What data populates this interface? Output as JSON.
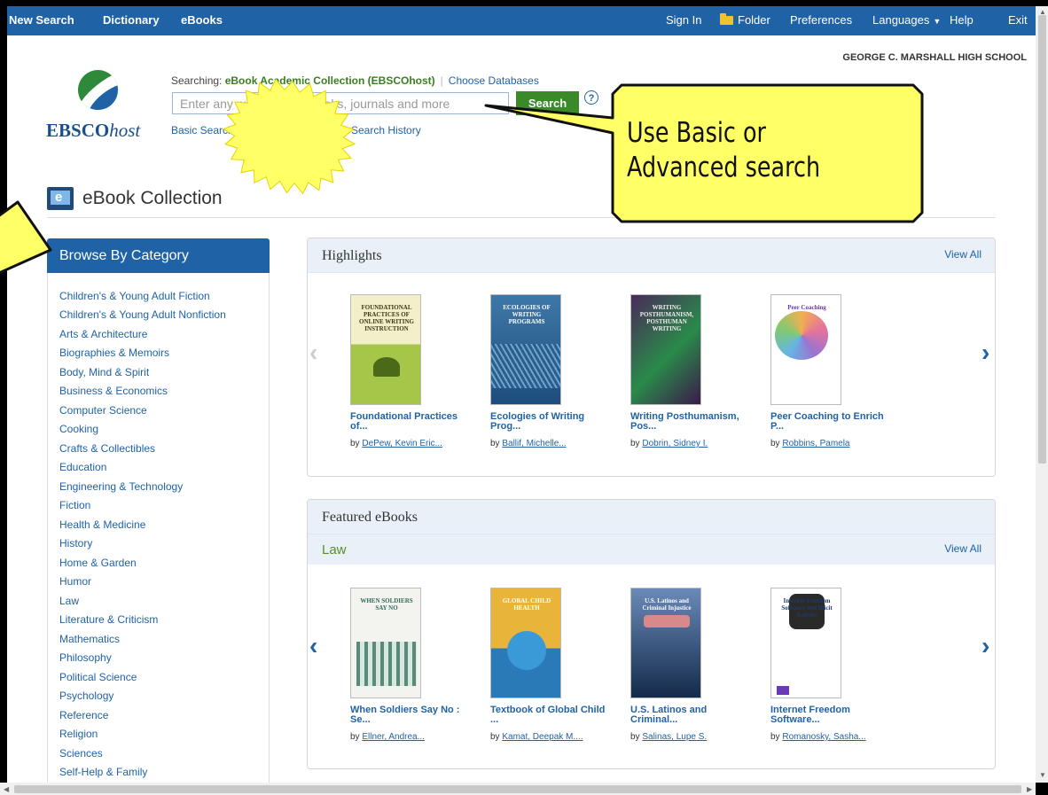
{
  "topbar": {
    "new_search": "New Search",
    "dictionary": "Dictionary",
    "ebooks": "eBooks",
    "sign_in": "Sign In",
    "folder": "Folder",
    "preferences": "Preferences",
    "languages": "Languages",
    "help": "Help",
    "exit": "Exit"
  },
  "institution": "GEORGE C. MARSHALL HIGH SCHOOL",
  "logo": {
    "brand": "EBSCO",
    "suffix": "host"
  },
  "search": {
    "searching_label": "Searching:",
    "database": "eBook Academic Collection (EBSCOhost)",
    "choose_databases": "Choose Databases",
    "placeholder": "Enter any words to find books, journals and more",
    "button": "Search",
    "help": "?",
    "basic": "Basic Search",
    "advanced": "Advanced Search",
    "history": "Search History"
  },
  "collection_title": "eBook Collection",
  "sidebar": {
    "title": "Browse By Category",
    "categories": [
      "Children's & Young Adult Fiction",
      "Children's & Young Adult Nonfiction",
      "Arts & Architecture",
      "Biographies & Memoirs",
      "Body, Mind & Spirit",
      "Business & Economics",
      "Computer Science",
      "Cooking",
      "Crafts & Collectibles",
      "Education",
      "Engineering & Technology",
      "Fiction",
      "Health & Medicine",
      "History",
      "Home & Garden",
      "Humor",
      "Law",
      "Literature & Criticism",
      "Mathematics",
      "Philosophy",
      "Political Science",
      "Psychology",
      "Reference",
      "Religion",
      "Sciences",
      "Self-Help & Family"
    ]
  },
  "highlights": {
    "title": "Highlights",
    "view_all": "View All",
    "prev": "‹",
    "next": "›",
    "books": [
      {
        "title": "Foundational Practices of...",
        "by": "by",
        "author": "DePew, Kevin Eric...",
        "cover_text": "FOUNDATIONAL PRACTICES OF ONLINE WRITING INSTRUCTION"
      },
      {
        "title": "Ecologies of Writing Prog...",
        "by": "by",
        "author": "Ballif, Michelle...",
        "cover_text": "ECOLOGIES OF WRITING PROGRAMS"
      },
      {
        "title": "Writing Posthumanism, Pos...",
        "by": "by",
        "author": "Dobrin, Sidney I.",
        "cover_text": "WRITING POSTHUMANISM, POSTHUMAN WRITING"
      },
      {
        "title": "Peer Coaching to Enrich P...",
        "by": "by",
        "author": "Robbins, Pamela",
        "cover_text": "Peer Coaching"
      }
    ]
  },
  "featured": {
    "title": "Featured eBooks",
    "subject": "Law",
    "view_all": "View All",
    "prev": "‹",
    "next": "›",
    "books": [
      {
        "title": "When Soldiers Say No : Se...",
        "by": "by",
        "author": "Ellner, Andrea...",
        "cover_text": "WHEN SOLDIERS SAY NO"
      },
      {
        "title": "Textbook of Global Child ...",
        "by": "by",
        "author": "Kamat, Deepak M....",
        "cover_text": "GLOBAL CHILD HEALTH"
      },
      {
        "title": "U.S. Latinos and Criminal...",
        "by": "by",
        "author": "Salinas, Lupe S.",
        "cover_text": "U.S. Latinos and Criminal Injustice"
      },
      {
        "title": "Internet Freedom Software...",
        "by": "by",
        "author": "Romanosky, Sasha...",
        "cover_text": "Internet Freedom Software and Illicit Activity"
      }
    ]
  },
  "annotation": {
    "line1": "Use Basic or",
    "line2": "Advanced search"
  },
  "colors": {
    "topbar": "#1f62a6",
    "link": "#1f62a6",
    "callout": "#ffff66",
    "search_button": "#3b8a2a"
  }
}
